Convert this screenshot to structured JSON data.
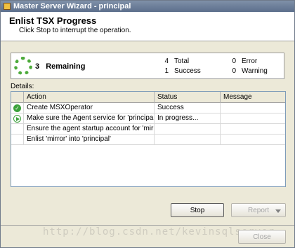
{
  "window": {
    "title": "Master Server Wizard - principal"
  },
  "header": {
    "title": "Enlist TSX Progress",
    "subtitle": "Click Stop to interrupt the operation."
  },
  "progress": {
    "remaining_count": "3",
    "remaining_label": "Remaining",
    "total_count": "4",
    "total_label": "Total",
    "success_count": "1",
    "success_label": "Success",
    "error_count": "0",
    "error_label": "Error",
    "warning_count": "0",
    "warning_label": "Warning"
  },
  "details": {
    "label": "Details:",
    "columns": {
      "action": "Action",
      "status": "Status",
      "message": "Message"
    },
    "rows": [
      {
        "icon": "success-icon",
        "action": "Create MSXOperator",
        "status": "Success",
        "message": ""
      },
      {
        "icon": "in-progress-icon",
        "action": "Make sure the Agent service for 'principal' is...",
        "status": "In progress...",
        "message": ""
      },
      {
        "icon": "",
        "action": "Ensure the agent startup account for 'mirror' ...",
        "status": "",
        "message": ""
      },
      {
        "icon": "",
        "action": "Enlist 'mirror' into 'principal'",
        "status": "",
        "message": ""
      }
    ]
  },
  "buttons": {
    "stop": "Stop",
    "report": "Report",
    "close": "Close"
  },
  "watermark": "http://blog.csdn.net/kevinsqlserver",
  "colors": {
    "success": "#3ca23c",
    "titlebar": "#5c6f8c"
  }
}
